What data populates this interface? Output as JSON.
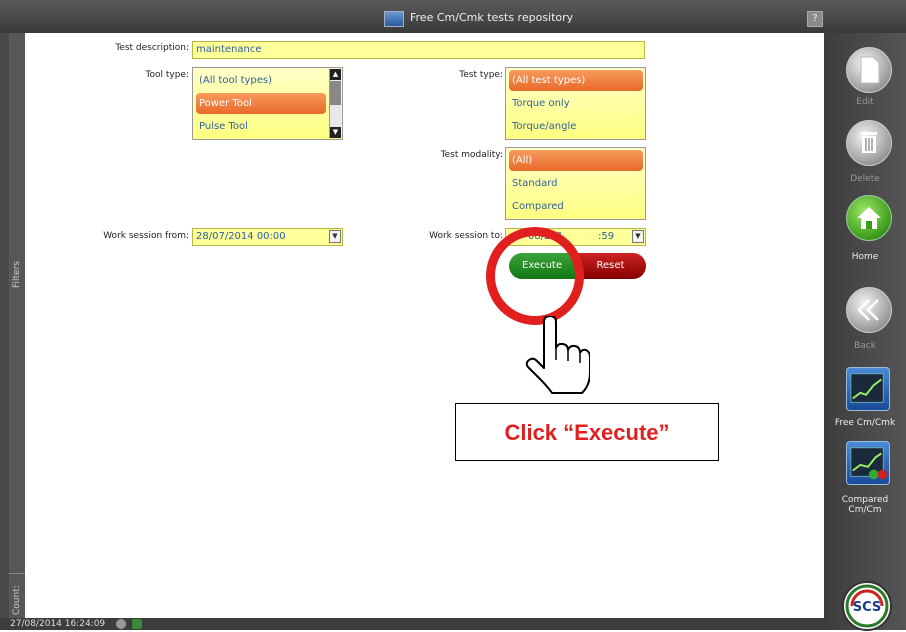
{
  "window": {
    "title": "Free Cm/Cmk tests repository",
    "help_label": "?"
  },
  "left_strip": {
    "filters_label": "Filters",
    "count_label": "Count:"
  },
  "filters": {
    "test_description_label": "Test description:",
    "test_description_value": "maintenance",
    "tool_type_label": "Tool type:",
    "tool_types": [
      "(All tool types)",
      "Power Tool",
      "Pulse Tool"
    ],
    "tool_type_selected": "Power Tool",
    "test_type_label": "Test type:",
    "test_types": [
      "(All test types)",
      "Torque only",
      "Torque/angle"
    ],
    "test_type_selected": "(All test types)",
    "test_modality_label": "Test modality:",
    "test_modalities": [
      "(All)",
      "Standard",
      "Compared"
    ],
    "test_modality_selected": "(All)",
    "work_session_from_label": "Work session from:",
    "work_session_from_value": "28/07/2014 00:00",
    "work_session_to_label": "Work session to:",
    "work_session_to_visible_start": "",
    "work_session_to_visible_mid": "08/201",
    "work_session_to_visible_end": ":59",
    "execute_label": "Execute",
    "reset_label": "Reset"
  },
  "annotation": {
    "callout_text": "Click “Execute”",
    "accent_color": "#e21f1f"
  },
  "right_panel": {
    "edit_label": "Edit",
    "delete_label": "Delete",
    "home_label": "Home",
    "back_label": "Back",
    "free_cm_label": "Free Cm/Cmk",
    "compared_cm_label": "Compared Cm/Cm",
    "logo_text": "SCS"
  },
  "status": {
    "timestamp": "27/08/2014 16:24:09"
  }
}
